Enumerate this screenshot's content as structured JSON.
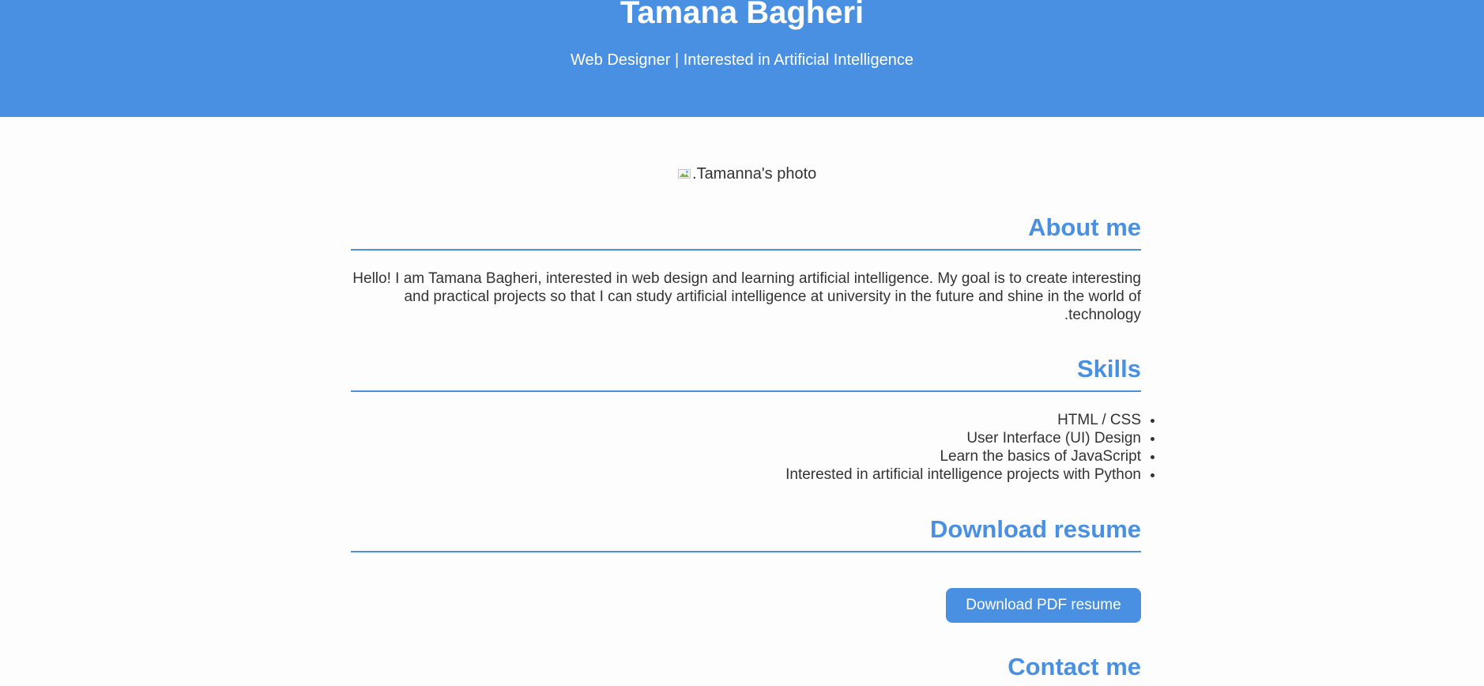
{
  "header": {
    "name": "Tamana Bagheri",
    "subtitle": "Web Designer | Interested in Artificial Intelligence"
  },
  "photo": {
    "alt": "Tamanna's photo."
  },
  "about": {
    "title": "About me",
    "text": "Hello! I am Tamana Bagheri, interested in web design and learning artificial intelligence. My goal is to create interesting and practical projects so that I can study artificial intelligence at university in the future and shine in the world of technology."
  },
  "skills": {
    "title": "Skills",
    "items": [
      "HTML / CSS",
      "User Interface (UI) Design",
      "Learn the basics of JavaScript",
      "Interested in artificial intelligence projects with Python"
    ]
  },
  "resume": {
    "title": "Download resume",
    "button_label": "Download PDF resume"
  },
  "contact": {
    "title": "Contact me"
  },
  "colors": {
    "accent": "#4a90e2",
    "text": "#333333",
    "background": "#fdfdfd"
  }
}
